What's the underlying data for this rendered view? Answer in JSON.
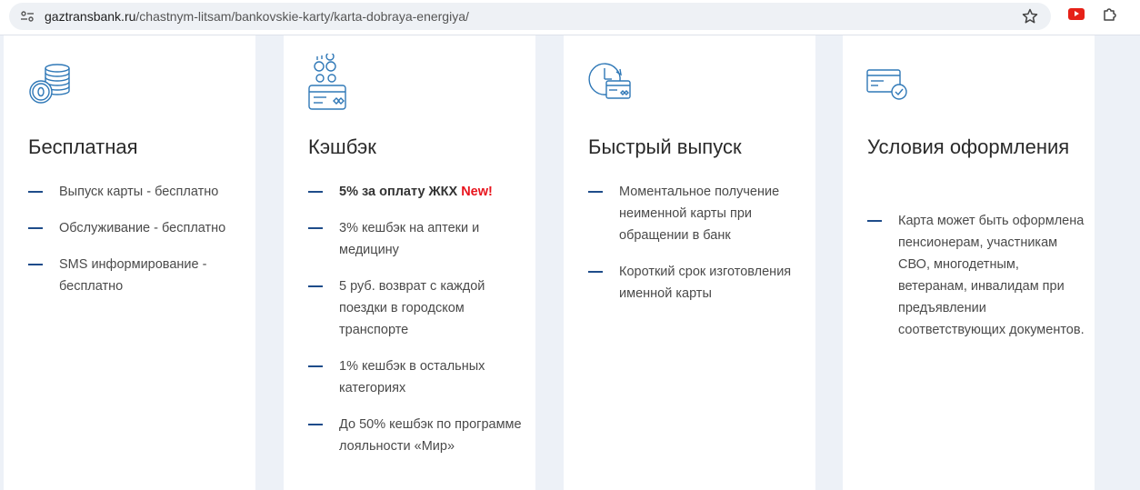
{
  "browser": {
    "url_host": "gaztransbank.ru",
    "url_path": "/chastnym-litsam/bankovskie-karty/karta-dobraya-energiya/"
  },
  "colors": {
    "accent": "#1e4c8a",
    "new_badge": "#e8141d",
    "icon_blue": "#2f78b7"
  },
  "cards": [
    {
      "icon": "coins-icon",
      "title": "Бесплатная",
      "items": [
        "Выпуск карты - бесплатно",
        "Обслуживание - бесплатно",
        "SMS информирование - бесплатно"
      ]
    },
    {
      "icon": "cashback-card-icon",
      "title": "Кэшбэк",
      "first_item": {
        "text": "5% за оплату ЖКХ",
        "badge": "New!"
      },
      "items": [
        "3% кешбэк на аптеки и медицину",
        "5 руб. возврат с каждой поездки в городском транспорте",
        "1% кешбэк в остальных категориях",
        "До 50% кешбэк по программе лояльности «Мир»"
      ]
    },
    {
      "icon": "clock-card-icon",
      "title": "Быстрый выпуск",
      "items": [
        "Моментальное получение неименной карты при обращении в банк",
        "Короткий срок изготовления именной карты"
      ]
    },
    {
      "icon": "card-check-icon",
      "title": "Условия оформления",
      "items": [
        "Карта может быть оформлена пенсионерам, участникам СВО, многодетным, ветеранам, инвалидам при предъявлении соответствующих документов."
      ]
    }
  ]
}
